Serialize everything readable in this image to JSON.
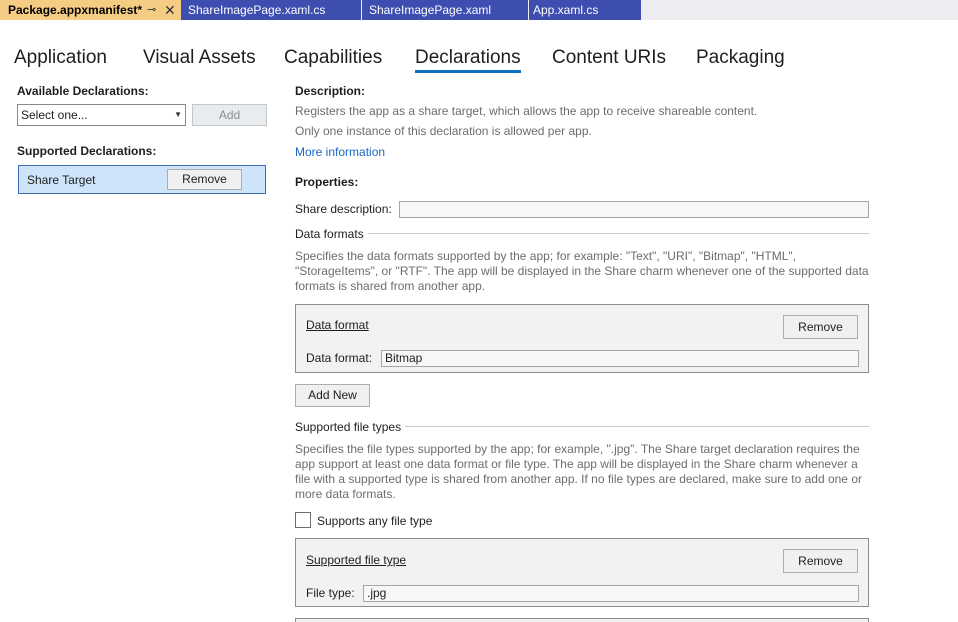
{
  "doc_tabs": {
    "active": {
      "label": "Package.appxmanifest*",
      "pin_glyph": "⊸",
      "close_glyph": "✕"
    },
    "others": [
      "ShareImagePage.xaml.cs",
      "ShareImagePage.xaml",
      "App.xaml.cs"
    ]
  },
  "designer_tabs": [
    "Application",
    "Visual Assets",
    "Capabilities",
    "Declarations",
    "Content URIs",
    "Packaging"
  ],
  "left": {
    "available_label": "Available Declarations:",
    "select_value": "Select one...",
    "add_label": "Add",
    "supported_label": "Supported Declarations:",
    "declaration_name": "Share Target",
    "remove_label": "Remove"
  },
  "right": {
    "description_label": "Description:",
    "description_line1": "Registers the app as a share target, which allows the app to receive shareable content.",
    "description_line2": "Only one instance of this declaration is allowed per app.",
    "more_info": "More information",
    "properties_label": "Properties:",
    "share_description_label": "Share description:",
    "share_description_value": "",
    "data_formats_heading": "Data formats",
    "data_formats_desc": "Specifies the data formats supported by the app; for example: \"Text\", \"URI\", \"Bitmap\", \"HTML\", \"StorageItems\", or \"RTF\". The app will be displayed in the Share charm whenever one of the supported data formats is shared from another app.",
    "data_format_group_title": "Data format",
    "data_format_remove": "Remove",
    "data_format_label": "Data format:",
    "data_format_value": "Bitmap",
    "add_new_label": "Add New",
    "file_types_heading": "Supported file types",
    "file_types_desc": "Specifies the file types supported by the app; for example, \".jpg\". The Share target declaration requires the app support at least one data format or file type. The app will be displayed in the Share charm whenever a file with a supported type is shared from another app. If no file types are declared, make sure to add one or more data formats.",
    "supports_any_label": "Supports any file type",
    "supports_any_checked": false,
    "file_type_group_title": "Supported file type",
    "file_type_remove": "Remove",
    "file_type_label": "File type:",
    "file_type_value": ".jpg"
  },
  "colors": {
    "active_tab": "#f5cc84",
    "inactive_tab": "#3d4db0",
    "selected_tab_underline": "#0e70c0",
    "selected_item": "#cde4fb",
    "link": "#1a66c6"
  }
}
